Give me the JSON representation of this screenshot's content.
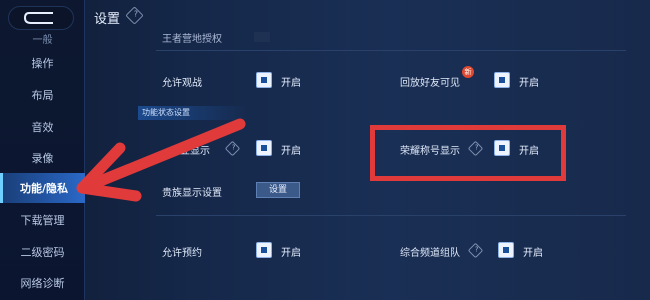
{
  "header": {
    "title": "设置",
    "info_glyph": "?"
  },
  "sidebar": {
    "items": [
      {
        "label": "一般",
        "state": "partial"
      },
      {
        "label": "操作"
      },
      {
        "label": "布局"
      },
      {
        "label": "音效"
      },
      {
        "label": "录像"
      },
      {
        "label": "功能/隐私",
        "active": true
      },
      {
        "label": "下载管理"
      },
      {
        "label": "二级密码"
      },
      {
        "label": "网络诊断"
      }
    ]
  },
  "settings": {
    "partial_row": {
      "label": "王者营地授权"
    },
    "allow_spectate": {
      "label": "允许观战",
      "toggle": "开启"
    },
    "replay_friends": {
      "label": "回放好友可见",
      "badge": "新",
      "toggle": "开启"
    },
    "section_header": "功能状态设置",
    "profession_display": {
      "label": "专业显示",
      "toggle": "开启"
    },
    "honor_title": {
      "label": "荣耀称号显示",
      "toggle": "开启"
    },
    "noble_display": {
      "label": "贵族显示设置",
      "button": "设置"
    },
    "allow_appointment": {
      "label": "允许预约",
      "toggle": "开启"
    },
    "channel_team": {
      "label": "综合频道组队",
      "toggle": "开启"
    }
  },
  "annotation": {
    "arrow_color": "#e03a3a",
    "box_color": "#e03a3a"
  }
}
